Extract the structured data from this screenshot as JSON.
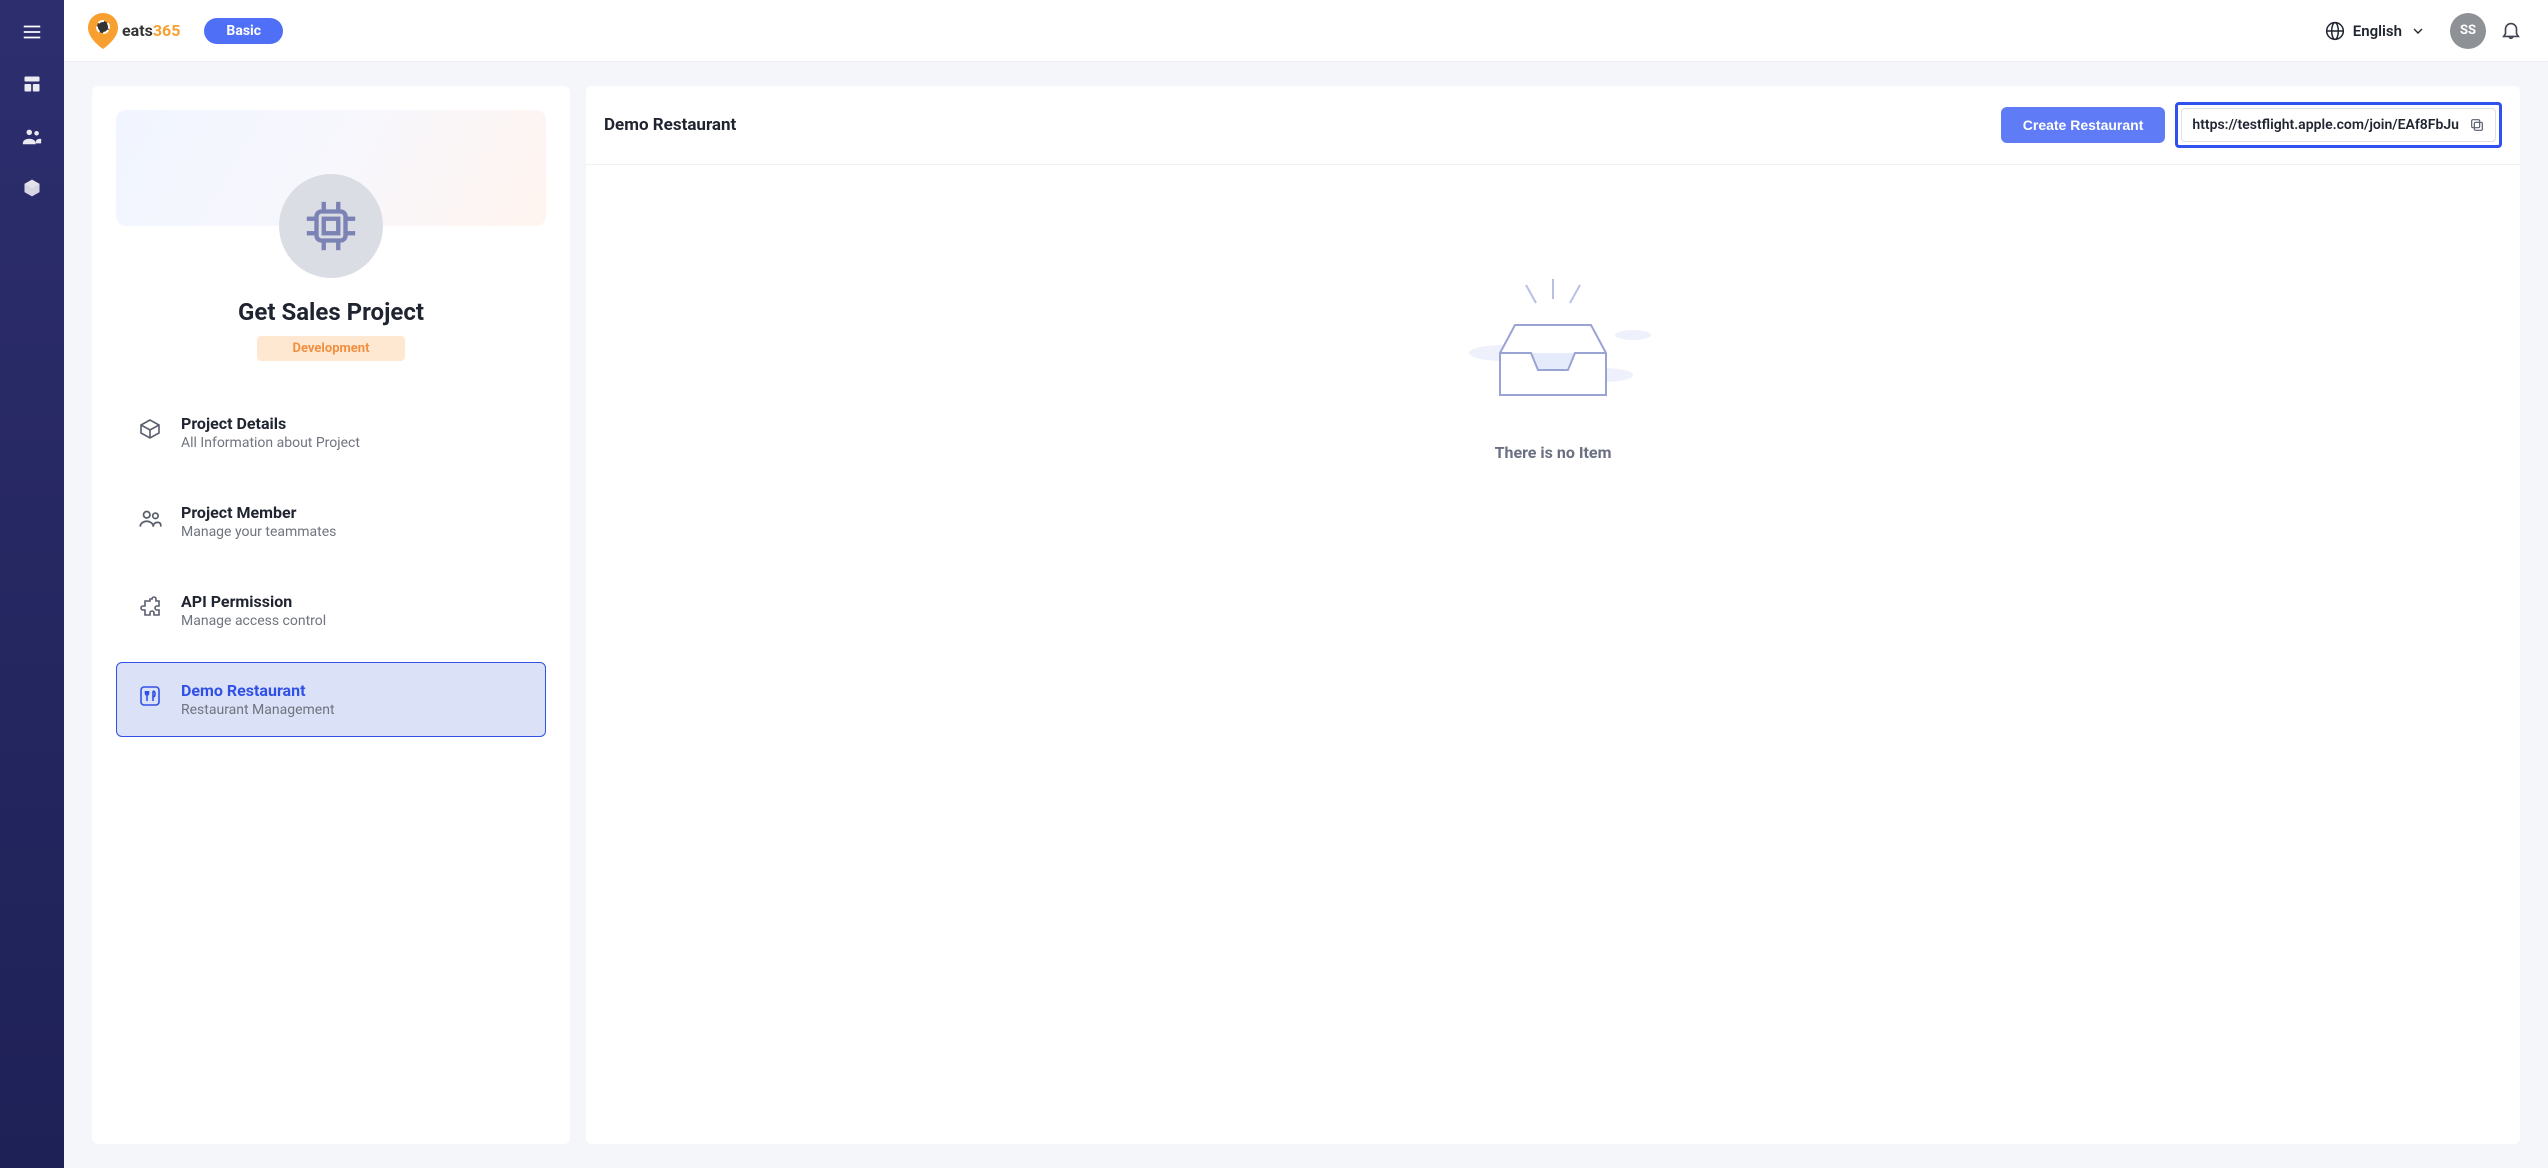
{
  "header": {
    "brand_a": "eats",
    "brand_b": "365",
    "tier_label": "Basic",
    "language_label": "English",
    "avatar_initials": "SS"
  },
  "sidebar_icons": {
    "menu": "menu",
    "dashboard": "dashboard-icon",
    "members": "members-icon",
    "products": "cube-icon"
  },
  "project": {
    "name": "Get Sales Project",
    "tag": "Development",
    "menu": [
      {
        "title": "Project Details",
        "subtitle": "All Information about Project"
      },
      {
        "title": "Project Member",
        "subtitle": "Manage your teammates"
      },
      {
        "title": "API Permission",
        "subtitle": "Manage access control"
      },
      {
        "title": "Demo Restaurant",
        "subtitle": "Restaurant Management"
      }
    ]
  },
  "main_panel": {
    "title": "Demo Restaurant",
    "create_button": "Create Restaurant",
    "share_link": "https://testflight.apple.com/join/EAf8FbJu",
    "empty_text": "There is no Item"
  }
}
